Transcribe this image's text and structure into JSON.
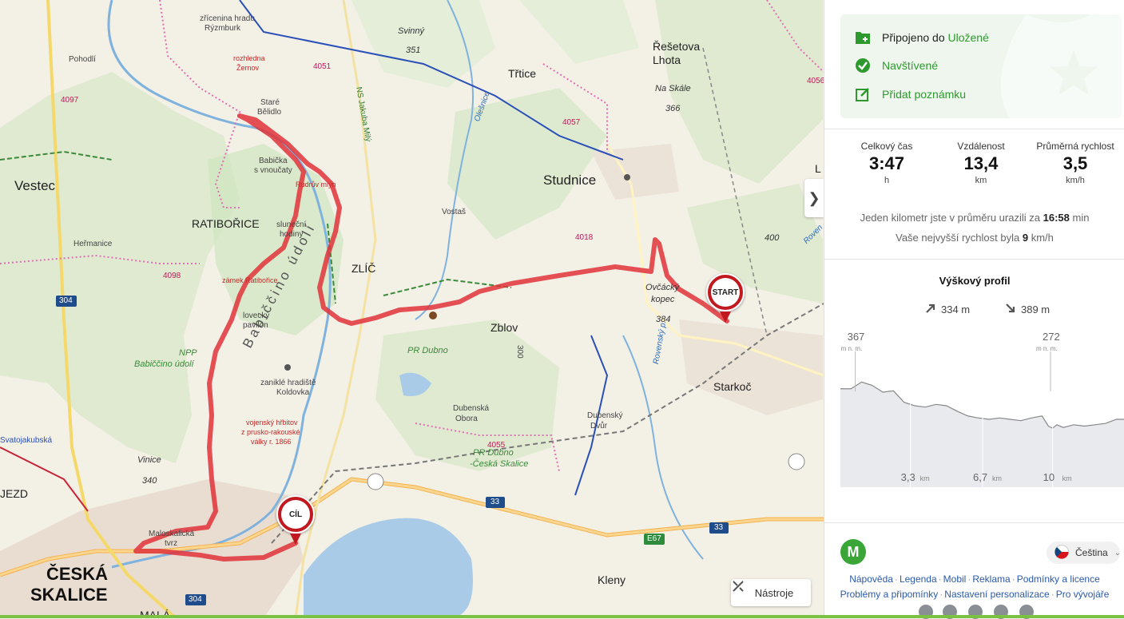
{
  "map": {
    "labels": {
      "vestec": "Vestec",
      "ratiborice": "RATIBOŘICE",
      "studnice": "Studnice",
      "zlic": "ZLÍČ",
      "zblov": "Zblov",
      "starkoc": "Starkoč",
      "kleny": "Kleny",
      "ceska": "ČESKÁ",
      "skalice": "SKALICE",
      "trtice": "Třtice",
      "resetova": "Řešetova",
      "lhota": "Lhota",
      "svinny": "Svinný",
      "svinny_ele": "351",
      "naskale": "Na Skále",
      "naskale_ele": "366",
      "ovcacky": "Ovčácký",
      "kopec": "kopec",
      "ovcacky_ele": "384",
      "e400": "400",
      "pohodli": "Pohodlí",
      "hermanice": "Heřmanice",
      "vostas": "Vostaš",
      "vinice": "Vinice",
      "vinice_ele": "340",
      "dubensky": "Dubenský",
      "dvur": "Dvůr",
      "dubenska": "Dubenská",
      "obora": "Obora",
      "pr_dubno": "PR Dubno",
      "pr_dubno2": "PR Dubno",
      "pr_dubno2b": "-Česká Skalice",
      "npp": "NPP",
      "babicino": "Babiččino údolí",
      "babicino_big": "Babiččino údolí",
      "stare": "Staré",
      "belidlo": "Bělidlo",
      "babicka": "Babička",
      "vnoucaty": "s vnoučaty",
      "rudruv": "Rudrův mlýn",
      "slunecni": "sluneční",
      "hodiny": "hodiny",
      "zamek": "zámek Ratibořice",
      "vyhlidkovy": "lovecký",
      "pavilon": "pavilon",
      "zanikle": "zaniklé hradiště",
      "koldovka": "Koldovka",
      "hrbitov1": "vojenský hřbitov",
      "hrbitov2": "z prusko-rakouské",
      "hrbitov3": "války r. 1866",
      "zricenina1": "zřícenina hradu",
      "zricenina2": "Rýzmburk",
      "rozhledna1": "rozhledna",
      "rozhledna2": "Žernov",
      "maloskalicka": "Maloskalická",
      "tvrz": "tvrz",
      "jezd": "JEZD",
      "svatojakubska": "Svatojakubská",
      "mala": "MALÁ",
      "ns": "NS Jakuba Milý",
      "olesnice": "Olešnice",
      "rovensky": "Rovenský p.",
      "rovensky2": "Roven",
      "r304a": "304",
      "r304b": "304",
      "r33a": "33",
      "r33b": "33",
      "e67": "E67",
      "n4057": "4057",
      "n4018": "4018",
      "n4055": "4055",
      "n4056": "4056",
      "n4051": "4051",
      "n4097": "4097",
      "n4098": "4098",
      "n300": "300",
      "l_letter": "L"
    },
    "start_label": "START",
    "finish_label": "CÍL",
    "tools_label": "Nástroje",
    "collapse_glyph": "❯"
  },
  "panel": {
    "actions": {
      "connected_prefix": "Připojeno do",
      "connected_link": "Uložené",
      "visited": "Navštívené",
      "add_note": "Přidat poznámku"
    },
    "stats": [
      {
        "label": "Celkový čas",
        "value": "3:47",
        "unit": "h"
      },
      {
        "label": "Vzdálenost",
        "value": "13,4",
        "unit": "km"
      },
      {
        "label": "Průměrná rychlost",
        "value": "3,5",
        "unit": "km/h"
      }
    ],
    "pace_sentence": {
      "prefix": "Jeden kilometr jste v průměru urazili za",
      "value": "16:58",
      "suffix": "min"
    },
    "speed_sentence": {
      "prefix": "Vaše nejvyšší rychlost byla",
      "value": "9",
      "suffix": "km/h"
    },
    "profile": {
      "title": "Výškový profil",
      "ascent": "334 m",
      "descent": "389 m"
    },
    "footer": {
      "language": "Čeština",
      "links_row1": [
        "Nápověda",
        "Legenda",
        "Mobil",
        "Reklama",
        "Podmínky a licence"
      ],
      "links_row2": [
        "Problémy a připomínky",
        "Nastavení personalizace",
        "Pro vývojáře"
      ]
    }
  },
  "chart_data": {
    "type": "area",
    "title": "Výškový profil",
    "x_unit": "km",
    "xlim": [
      0,
      13.4
    ],
    "x_ticks": [
      "3,3",
      "6,7",
      "10"
    ],
    "tick_unit": "km",
    "peak_labels": [
      {
        "value": "367",
        "unit": "m n. m.",
        "x": 0.7
      },
      {
        "value": "272",
        "unit": "m n. m.",
        "x": 9.9
      }
    ],
    "ylim": [
      200,
      400
    ],
    "series": [
      {
        "x": [
          0,
          0.5,
          1.0,
          1.5,
          2.0,
          2.5,
          3.0,
          3.5,
          4.0,
          4.5,
          5.0,
          5.5,
          6.0,
          6.5,
          7.0,
          7.5,
          8.0,
          8.5,
          9.0,
          9.5,
          9.8,
          10.0,
          10.2,
          10.5,
          11.0,
          11.5,
          12.0,
          12.5,
          13.0,
          13.4
        ],
        "y": [
          345,
          345,
          355,
          350,
          340,
          342,
          325,
          320,
          318,
          322,
          320,
          312,
          305,
          302,
          300,
          302,
          300,
          298,
          302,
          305,
          290,
          287,
          292,
          288,
          292,
          290,
          292,
          294,
          300,
          300
        ]
      }
    ]
  }
}
